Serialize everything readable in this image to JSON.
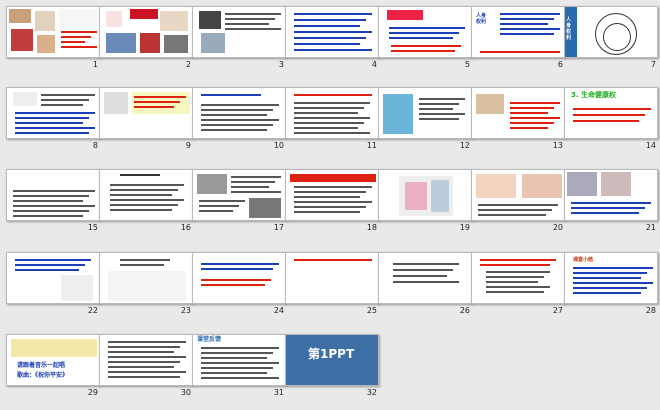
{
  "slides": [
    {
      "n": "1",
      "title": "生命和健康的权利",
      "sub": "第三课 生命健康不容侵犯"
    },
    {
      "n": "2",
      "title": "我是我 世上独一无二",
      "sub": "我是我"
    },
    {
      "n": "3",
      "title": "",
      "sub": ""
    },
    {
      "n": "4",
      "title": "死",
      "sub": ""
    },
    {
      "n": "5",
      "title": "",
      "sub": ""
    },
    {
      "n": "6",
      "title": "人身权利",
      "sub": "人身权利是公民最基本、最重要的权利。"
    },
    {
      "n": "7",
      "title": "人身权利",
      "sub": "生命健康权是人格权"
    },
    {
      "n": "8",
      "title": "权利关系图",
      "sub": ""
    },
    {
      "n": "9",
      "title": "",
      "sub": ""
    },
    {
      "n": "10",
      "title": "",
      "sub": ""
    },
    {
      "n": "11",
      "title": "",
      "sub": ""
    },
    {
      "n": "12",
      "title": "",
      "sub": ""
    },
    {
      "n": "13",
      "title": "",
      "sub": ""
    },
    {
      "n": "14",
      "title": "3. 生命健康权",
      "sub": ""
    },
    {
      "n": "15",
      "title": "侵害大搜索",
      "sub": ""
    },
    {
      "n": "16",
      "title": "",
      "sub": ""
    },
    {
      "n": "17",
      "title": "",
      "sub": ""
    },
    {
      "n": "18",
      "title": "",
      "sub": ""
    },
    {
      "n": "19",
      "title": "",
      "sub": ""
    },
    {
      "n": "20",
      "title": "",
      "sub": ""
    },
    {
      "n": "21",
      "title": "",
      "sub": ""
    },
    {
      "n": "22",
      "title": "",
      "sub": ""
    },
    {
      "n": "23",
      "title": "",
      "sub": ""
    },
    {
      "n": "24",
      "title": "",
      "sub": ""
    },
    {
      "n": "25",
      "title": "",
      "sub": ""
    },
    {
      "n": "26",
      "title": "",
      "sub": ""
    },
    {
      "n": "27",
      "title": "",
      "sub": ""
    },
    {
      "n": "28",
      "title": "课堂小结",
      "sub": ""
    },
    {
      "n": "29",
      "title": "请跟着音乐一起唱",
      "sub": "歌曲：《祝你平安》"
    },
    {
      "n": "30",
      "title": "",
      "sub": ""
    },
    {
      "n": "31",
      "title": "课堂反馈",
      "sub": ""
    },
    {
      "n": "32",
      "title": "第1PPT",
      "sub": ""
    }
  ],
  "colors": {
    "accent": "#3b6fd6",
    "red": "#d21",
    "blue": "#1a3fb8"
  }
}
